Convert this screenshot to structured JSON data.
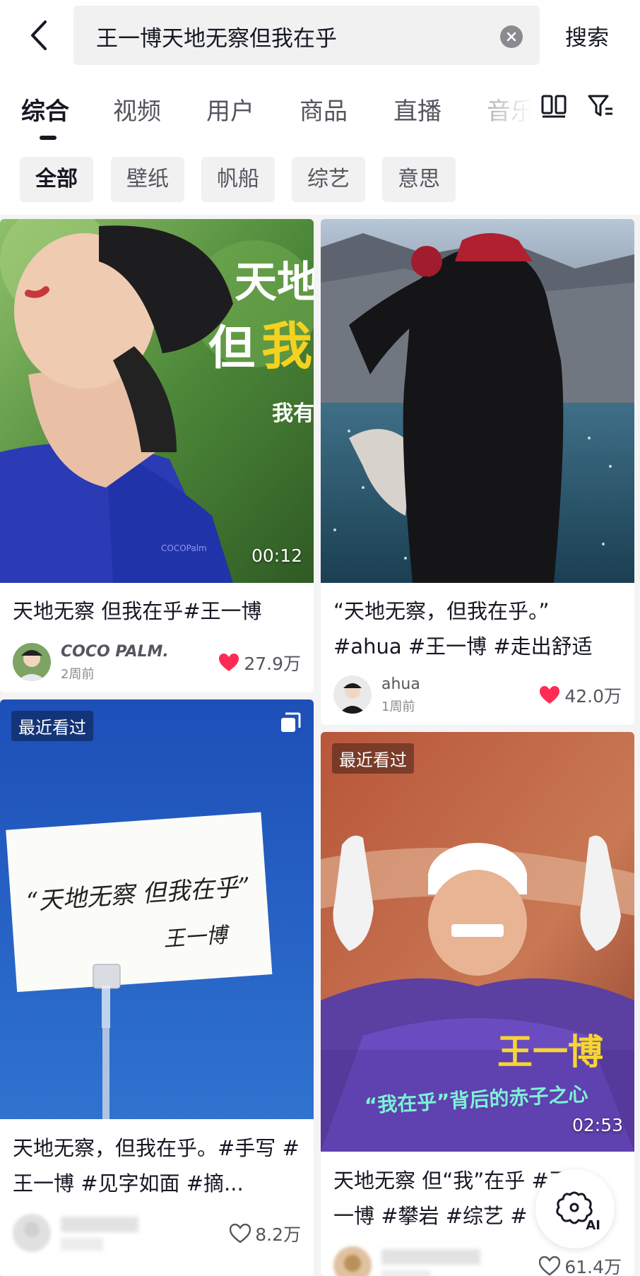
{
  "search": {
    "query": "王一博天地无察但我在乎",
    "submit_label": "搜索"
  },
  "tabs": [
    {
      "label": "综合",
      "active": true
    },
    {
      "label": "视频",
      "active": false
    },
    {
      "label": "用户",
      "active": false
    },
    {
      "label": "商品",
      "active": false
    },
    {
      "label": "直播",
      "active": false
    },
    {
      "label": "音乐",
      "active": false
    }
  ],
  "chips": [
    {
      "label": "全部",
      "active": true
    },
    {
      "label": "壁纸",
      "active": false
    },
    {
      "label": "帆船",
      "active": false
    },
    {
      "label": "综艺",
      "active": false
    },
    {
      "label": "意思",
      "active": false
    }
  ],
  "cards": [
    {
      "title": "天地无察 但我在乎#王一博",
      "author": "COCO PALM.",
      "time": "2周前",
      "likes": "27.9万",
      "liked": true,
      "duration": "00:12",
      "overlay_text": {
        "line1": "天地",
        "line2a": "但",
        "line2b": "我",
        "line3": "我有",
        "watermark": "COCOPalm"
      }
    },
    {
      "title": "“天地无察，但我在乎。” #ahua #王一博 #走出舒适圈...",
      "author": "ahua",
      "time": "1周前",
      "likes": "42.0万",
      "liked": true
    },
    {
      "title": "天地无察，但我在乎。#手写 #王一博 #见字如面 #摘...",
      "author": "",
      "time": "",
      "likes": "8.2万",
      "liked": false,
      "recent": "最近看过",
      "handwriting": {
        "line1": "“天地无察 但我在乎”",
        "line2": "王一博"
      }
    },
    {
      "title": "天地无察 但“我”在乎 #王一博 #攀岩 #综艺 #",
      "author": "",
      "time": "",
      "likes": "61.4万",
      "liked": false,
      "recent": "最近看过",
      "duration": "02:53",
      "overlay_text": {
        "name": "王一博",
        "caption": "“我在乎”背后的赤子之心"
      }
    }
  ],
  "ai_button": {
    "label": "AI"
  },
  "colors": {
    "accent": "#fe2c55",
    "text": "#161823",
    "muted": "#8a8b91"
  },
  "icons": [
    "back-arrow-icon",
    "clear-icon",
    "grid-view-icon",
    "filter-icon",
    "heart-icon",
    "multi-image-icon",
    "ai-icon"
  ]
}
